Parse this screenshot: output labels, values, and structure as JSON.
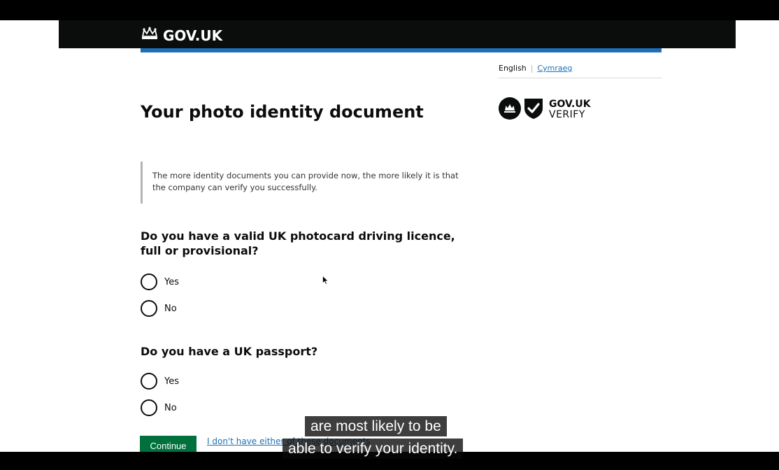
{
  "header": {
    "logo_text": "GOV.UK",
    "logo_icon": "crown-icon"
  },
  "language": {
    "english": "English",
    "welsh": "Cymraeg"
  },
  "verify_badge": {
    "line1": "GOV.UK",
    "line2": "VERIFY"
  },
  "page": {
    "title": "Your photo identity document",
    "inset_text": "The more identity documents you can provide now, the more likely it is that the company can verify you successfully."
  },
  "questions": [
    {
      "label": "Do you have a valid UK photocard driving licence, full or provisional?",
      "options": [
        "Yes",
        "No"
      ]
    },
    {
      "label": "Do you have a UK passport?",
      "options": [
        "Yes",
        "No"
      ]
    }
  ],
  "actions": {
    "continue_label": "Continue",
    "none_link": "I don't have either of these documents"
  },
  "captions": {
    "line1": "are most likely to be",
    "line2": "able to verify your identity."
  },
  "colors": {
    "header_bg": "#0b0c0c",
    "header_rule": "#1d70b8",
    "button": "#00703c",
    "link": "#1d70b8"
  }
}
